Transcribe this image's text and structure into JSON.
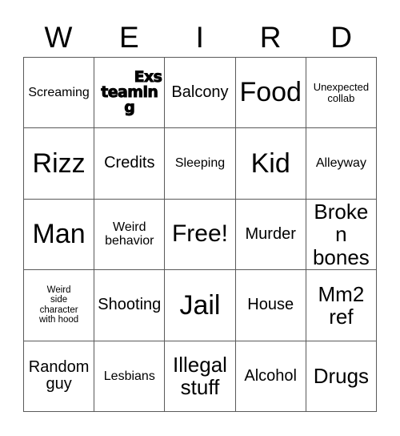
{
  "card": {
    "title_letters": [
      "W",
      "E",
      "I",
      "R",
      "D"
    ],
    "rows": [
      [
        {
          "text": "Screaming",
          "size": "sz-sm"
        },
        {
          "text": "Exs\nteaming",
          "size": "heavy",
          "style": "heavy"
        },
        {
          "text": "Balcony",
          "size": "sz-md"
        },
        {
          "text": "Food",
          "size": "sz-xxl"
        },
        {
          "text": "Unexpected\ncollab",
          "size": "sz-xs"
        }
      ],
      [
        {
          "text": "Rizz",
          "size": "sz-xxl"
        },
        {
          "text": "Credits",
          "size": "sz-md"
        },
        {
          "text": "Sleeping",
          "size": "sz-sm"
        },
        {
          "text": "Kid",
          "size": "sz-xxl"
        },
        {
          "text": "Alleyway",
          "size": "sz-sm"
        }
      ],
      [
        {
          "text": "Man",
          "size": "sz-xxl"
        },
        {
          "text": "Weird\nbehavior",
          "size": "sz-sm"
        },
        {
          "text": "Free!",
          "size": "sz-xl"
        },
        {
          "text": "Murder",
          "size": "sz-md"
        },
        {
          "text": "Broken\nbones",
          "size": "sz-lg"
        }
      ],
      [
        {
          "text": "Weird\nside\ncharacter\nwith hood",
          "size": "sz-xxs"
        },
        {
          "text": "Shooting",
          "size": "sz-md"
        },
        {
          "text": "Jail",
          "size": "sz-xxl"
        },
        {
          "text": "House",
          "size": "sz-md"
        },
        {
          "text": "Mm2\nref",
          "size": "sz-lg"
        }
      ],
      [
        {
          "text": "Random\nguy",
          "size": "sz-md"
        },
        {
          "text": "Lesbians",
          "size": "sz-sm"
        },
        {
          "text": "Illegal\nstuff",
          "size": "sz-lg"
        },
        {
          "text": "Alcohol",
          "size": "sz-md"
        },
        {
          "text": "Drugs",
          "size": "sz-lg"
        }
      ]
    ]
  },
  "colors": {
    "background": "#ffffff",
    "text": "#000000",
    "grid_line": "#5a5a5a"
  }
}
